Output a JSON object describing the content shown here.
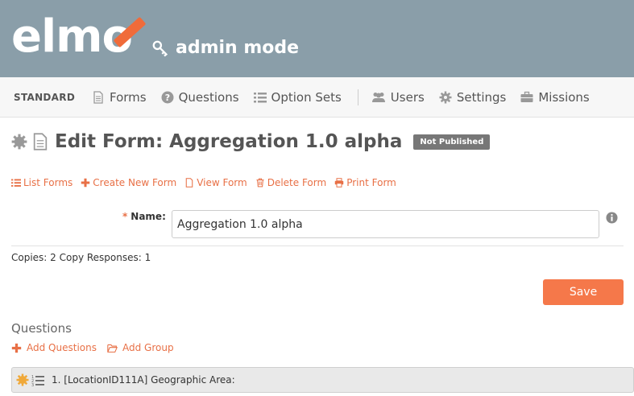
{
  "brand": {
    "logo_text": "elmo",
    "mode_label": "admin mode"
  },
  "nav": {
    "mission_label": "STANDARD",
    "items": [
      {
        "label": "Forms",
        "icon": "file-icon"
      },
      {
        "label": "Questions",
        "icon": "question-circle-icon"
      },
      {
        "label": "Option Sets",
        "icon": "list-icon"
      },
      {
        "label": "Users",
        "icon": "users-icon"
      },
      {
        "label": "Settings",
        "icon": "gear-icon"
      },
      {
        "label": "Missions",
        "icon": "briefcase-icon"
      }
    ]
  },
  "page": {
    "title": "Edit Form: Aggregation 1.0 alpha",
    "status_badge": "Not Published"
  },
  "actions": [
    {
      "label": "List Forms",
      "icon": "list-icon"
    },
    {
      "label": "Create New Form",
      "icon": "plus-icon"
    },
    {
      "label": "View Form",
      "icon": "file-icon"
    },
    {
      "label": "Delete Form",
      "icon": "trash-icon"
    },
    {
      "label": "Print Form",
      "icon": "print-icon"
    }
  ],
  "form": {
    "required_marker": "*",
    "name_label": "Name:",
    "name_value": "Aggregation 1.0 alpha",
    "copies_text": "Copies: 2   Copy Responses: 1",
    "save_label": "Save"
  },
  "questions": {
    "heading": "Questions",
    "add_questions_label": "Add Questions",
    "add_group_label": "Add Group",
    "items": [
      {
        "text": "1. [LocationID111A] Geographic Area:",
        "type_icon": "select-list-icon"
      }
    ]
  },
  "colors": {
    "header_bg": "#8a9ea9",
    "accent": "#e87046",
    "save_button": "#f5784a",
    "badge_bg": "#777777"
  }
}
